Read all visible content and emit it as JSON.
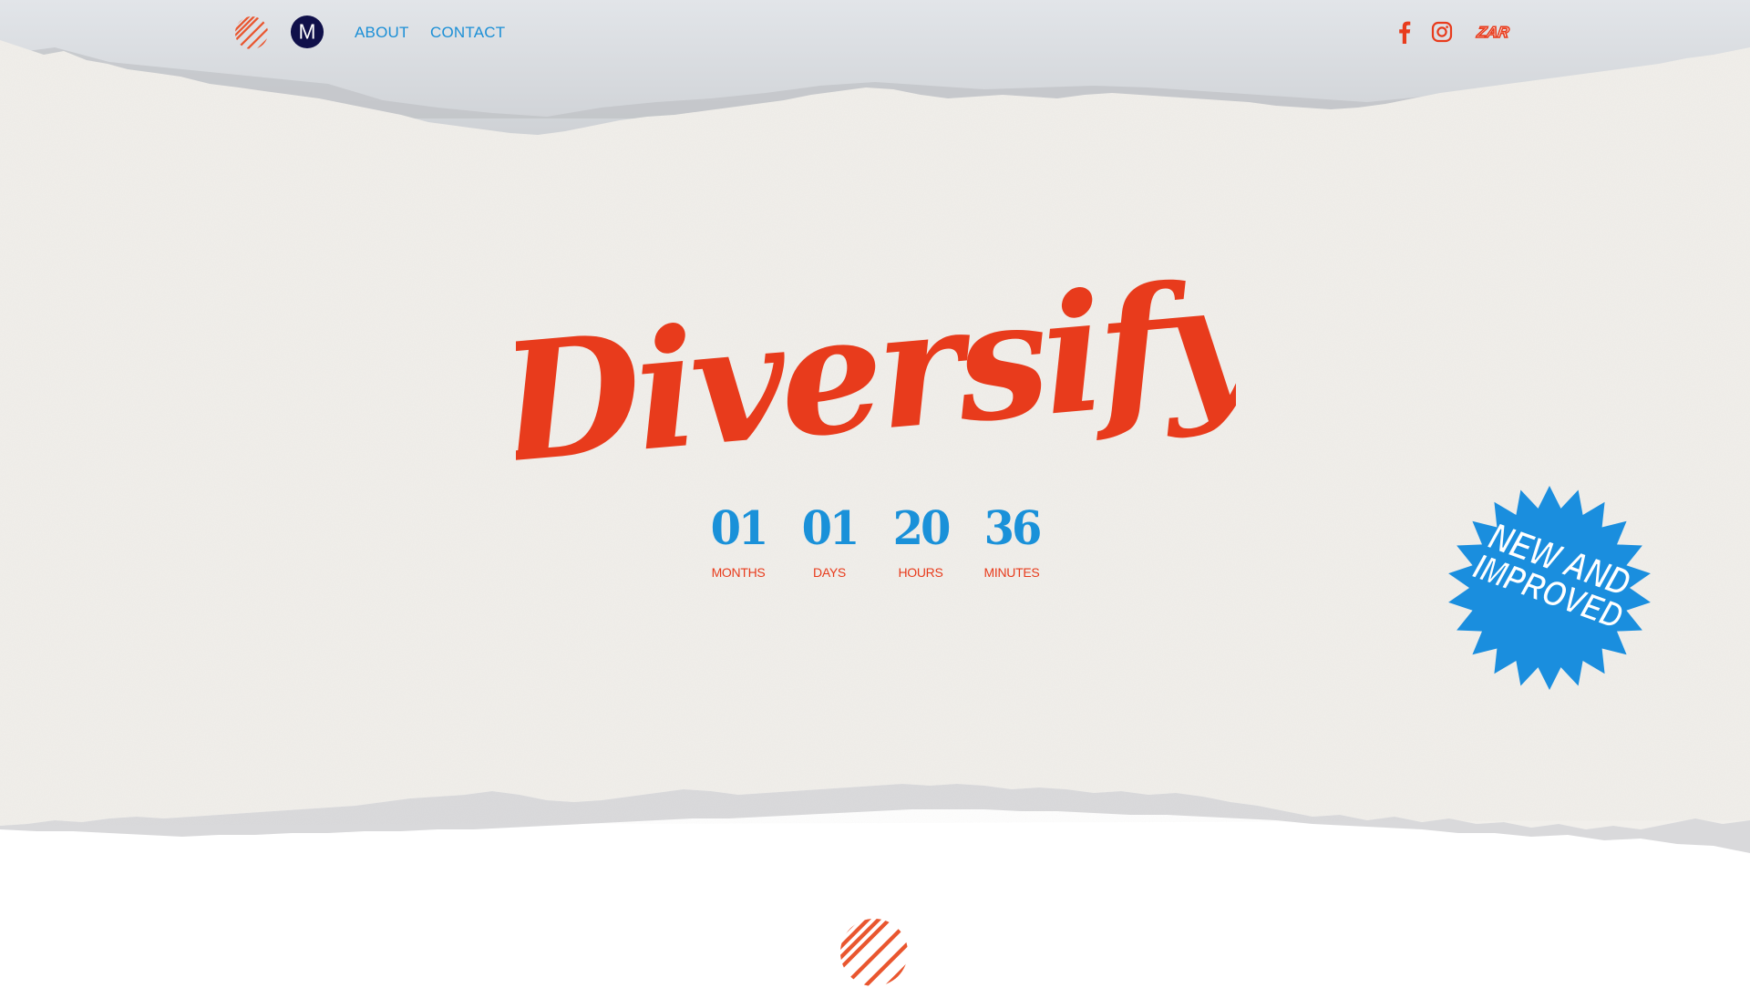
{
  "nav": {
    "about_label": "ABOUT",
    "contact_label": "CONTACT",
    "zar_label": "ZAR",
    "m_logo_label": "M"
  },
  "hero": {
    "title": "Diversify"
  },
  "countdown": [
    {
      "value": "01",
      "label": "MONTHS"
    },
    {
      "value": "01",
      "label": "DAYS"
    },
    {
      "value": "20",
      "label": "HOURS"
    },
    {
      "value": "36",
      "label": "MINUTES"
    }
  ],
  "badge": {
    "line1": "NEW AND",
    "line2": "IMPROVED"
  },
  "icons": {
    "stripe_logo": "striped-circle-icon",
    "m_logo": "m-logo-icon",
    "facebook": "facebook-icon",
    "instagram": "instagram-icon",
    "zar": "zar-logo-icon"
  },
  "colors": {
    "accent_orange": "#e83b1c",
    "accent_blue": "#1a91d9",
    "navy": "#10104a",
    "paper": "#f1efeb",
    "backdrop": "#dcdfe3"
  }
}
